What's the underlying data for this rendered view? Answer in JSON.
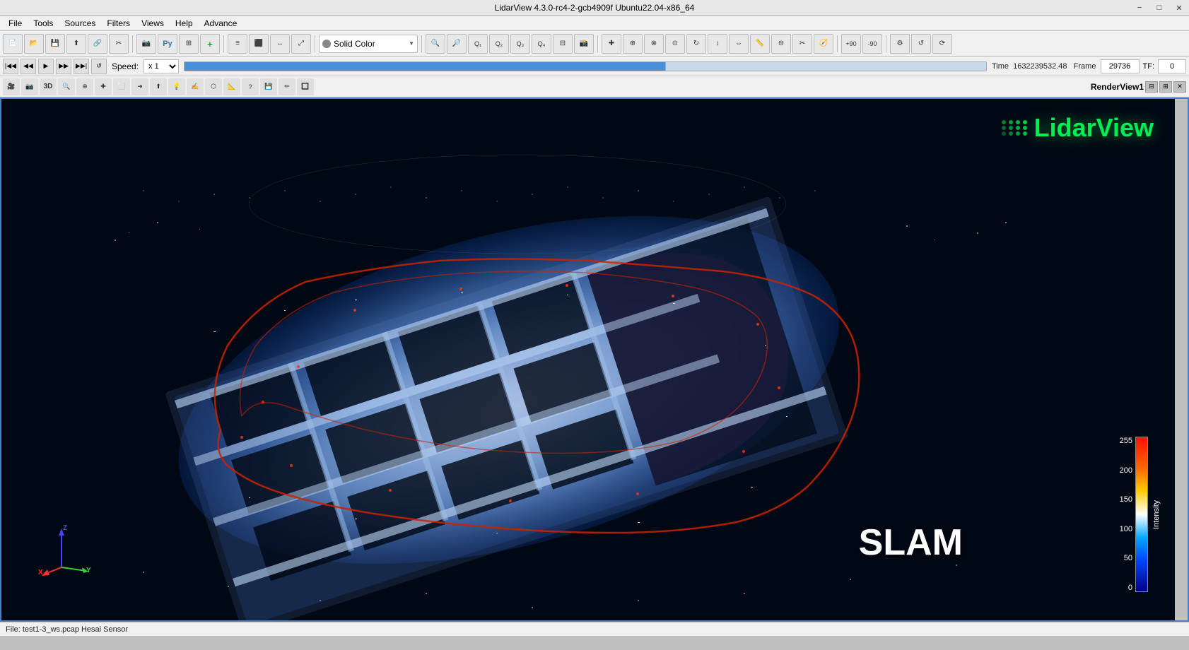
{
  "titlebar": {
    "title": "LidarView 4.3.0-rc4-2-gcb4909f Ubuntu22.04-x86_64",
    "minimize": "−",
    "maximize": "□",
    "close": "✕"
  },
  "menubar": {
    "items": [
      "File",
      "Tools",
      "Sources",
      "Filters",
      "Views",
      "Help",
      "Advance"
    ]
  },
  "toolbar": {
    "color_label": "Solid Color",
    "color_dot": "#888888"
  },
  "playback": {
    "speed_label": "Speed:",
    "speed_value": "x 1",
    "time_label": "Time",
    "time_value": "1632239532.48",
    "frame_label": "Frame",
    "frame_value": "29736",
    "tf_label": "TF:",
    "tf_value": "0"
  },
  "render": {
    "title": "RenderView1"
  },
  "colorbar": {
    "title": "Intensity",
    "labels": [
      "255",
      "200",
      "150",
      "100",
      "50",
      "0"
    ]
  },
  "slam_label": "SLAM",
  "statusbar": {
    "text": "File: test1-3_ws.pcap  Hesai Sensor"
  },
  "lidar_logo": "LidarView"
}
